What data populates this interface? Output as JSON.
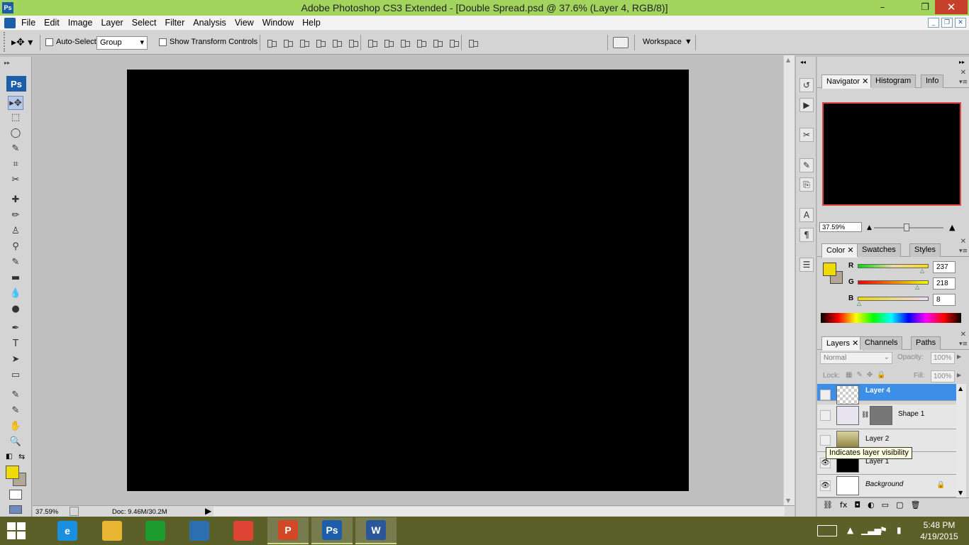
{
  "window": {
    "title": "Adobe Photoshop CS3 Extended - [Double Spread.psd @ 37.6% (Layer 4, RGB/8)]",
    "app_badge": "Ps",
    "min_label": "–",
    "max_label": "❐",
    "close_label": "✕"
  },
  "menu": {
    "items": [
      "File",
      "Edit",
      "Image",
      "Layer",
      "Select",
      "Filter",
      "Analysis",
      "View",
      "Window",
      "Help"
    ]
  },
  "options": {
    "auto_select_label": "Auto-Select:",
    "auto_select_value": "Group",
    "show_transform_label": "Show Transform Controls",
    "workspace_label": "Workspace"
  },
  "toolbox": {
    "badge": "Ps",
    "grip": "▸▸",
    "tools": [
      "▸✥",
      "⬚",
      "◯",
      "✎",
      "⌗",
      "✂",
      "✚",
      "✏",
      "♙",
      "⚲",
      "✎",
      "▬",
      "💧",
      "●",
      "✒",
      "T",
      "➤",
      "▭",
      "✎",
      "✎",
      "✋",
      "🔍"
    ],
    "tool_icons": [
      "move-tool-icon",
      "marquee-tool-icon",
      "lasso-tool-icon",
      "magic-wand-icon",
      "crop-tool-icon",
      "slice-tool-icon",
      "healing-brush-icon",
      "brush-tool-icon",
      "clone-stamp-icon",
      "history-brush-icon",
      "eraser-tool-icon",
      "gradient-tool-icon",
      "blur-tool-icon",
      "dodge-tool-icon",
      "pen-tool-icon",
      "type-tool-icon",
      "path-selection-icon",
      "shape-tool-icon",
      "notes-tool-icon",
      "eyedropper-tool-icon",
      "hand-tool-icon",
      "zoom-tool-icon"
    ],
    "foreground_color": "#edda08",
    "background_color": "#b4a695"
  },
  "status": {
    "zoom": "37.59%",
    "doc": "Doc: 9.46M/30.2M"
  },
  "panels": {
    "navigator_tabs": [
      "Navigator",
      "Histogram",
      "Info"
    ],
    "navigator_zoom": "37.59%",
    "color_tabs": [
      "Color",
      "Swatches",
      "Styles"
    ],
    "color": {
      "r_label": "R",
      "r_value": "237",
      "g_label": "G",
      "g_value": "218",
      "b_label": "B",
      "b_value": "8"
    },
    "layers_tabs": [
      "Layers",
      "Channels",
      "Paths"
    ],
    "blend_mode": "Normal",
    "opacity_label": "Opacity:",
    "opacity_value": "100%",
    "lock_label": "Lock:",
    "fill_label": "Fill:",
    "fill_value": "100%",
    "layers": [
      {
        "name": "Layer 4",
        "selected": true,
        "visible": false
      },
      {
        "name": "Shape 1",
        "selected": false,
        "visible": false
      },
      {
        "name": "Layer 2",
        "selected": false,
        "visible": false
      },
      {
        "name": "Layer 1",
        "selected": false,
        "visible": true
      },
      {
        "name": "Background",
        "selected": false,
        "visible": true
      }
    ],
    "tooltip": "Indicates layer visibility"
  },
  "taskbar": {
    "time": "5:48 PM",
    "date": "4/19/2015",
    "apps": [
      "Internet Explorer",
      "File Explorer",
      "Store",
      "Remote Desktop",
      "Chrome",
      "PowerPoint",
      "Photoshop",
      "Word"
    ],
    "app_badges": [
      "e",
      "",
      "",
      "",
      "",
      "P",
      "Ps",
      "W"
    ]
  }
}
